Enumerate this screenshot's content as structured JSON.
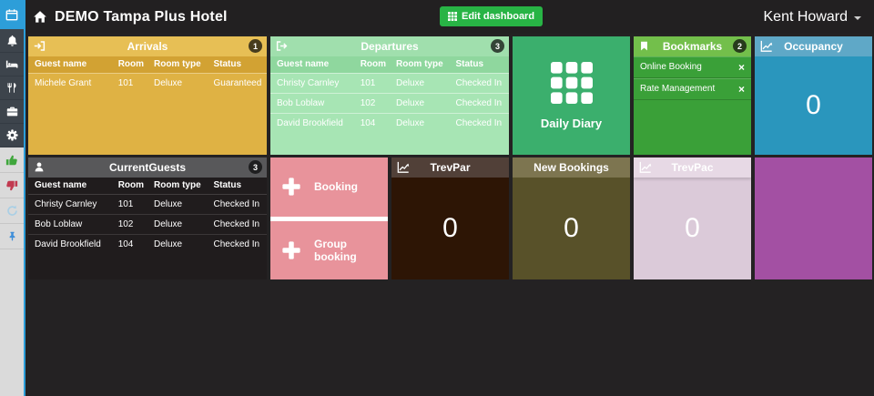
{
  "topbar": {
    "title": "DEMO Tampa Plus Hotel",
    "edit_button": "Edit dashboard",
    "user": "Kent Howard"
  },
  "sidebar": {
    "icons": [
      "calendar",
      "bell",
      "bed",
      "restaurant",
      "briefcase",
      "settings",
      "thumbs-up",
      "thumbs-down",
      "refresh",
      "pin"
    ]
  },
  "table_columns": [
    "Guest name",
    "Room",
    "Room type",
    "Status"
  ],
  "widgets": {
    "arrivals": {
      "title": "Arrivals",
      "badge": "1",
      "rows": [
        [
          "Michele Grant",
          "101",
          "Deluxe",
          "Guaranteed"
        ]
      ]
    },
    "departures": {
      "title": "Departures",
      "badge": "3",
      "rows": [
        [
          "Christy Carnley",
          "101",
          "Deluxe",
          "Checked In"
        ],
        [
          "Bob Loblaw",
          "102",
          "Deluxe",
          "Checked In"
        ],
        [
          "David Brookfield",
          "104",
          "Deluxe",
          "Checked In"
        ]
      ]
    },
    "daily_diary": {
      "label": "Daily Diary"
    },
    "bookmarks": {
      "title": "Bookmarks",
      "badge": "2",
      "items": [
        "Online Booking",
        "Rate Management"
      ],
      "close_glyph": "×"
    },
    "occupancy": {
      "title": "Occupancy",
      "value": "0"
    },
    "current_guests": {
      "title": "CurrentGuests",
      "badge": "3",
      "rows": [
        [
          "Christy Carnley",
          "101",
          "Deluxe",
          "Checked In"
        ],
        [
          "Bob Loblaw",
          "102",
          "Deluxe",
          "Checked In"
        ],
        [
          "David Brookfield",
          "104",
          "Deluxe",
          "Checked In"
        ]
      ]
    },
    "booking": {
      "label": "Booking"
    },
    "group_booking": {
      "label": "Group booking"
    },
    "trevpar": {
      "title": "TrevPar",
      "value": "0"
    },
    "new_bookings": {
      "title": "New Bookings",
      "value": "0"
    },
    "trevpac": {
      "title": "TrevPac",
      "value": "0"
    }
  },
  "colors": {
    "accent_blue": "#2d9ed9",
    "edit_green": "#28b445",
    "arrivals_gold": "#dfb244",
    "departures_green": "#a7e5b4",
    "diary_green": "#3baf6d",
    "bookmarks_green": "#3aa038",
    "occupancy_blue": "#2a96bd",
    "booking_pink": "#e8939b",
    "trevpar_brown": "#2d1505",
    "new_bookings_olive": "#585129",
    "trevpac_pink": "#dbcad9",
    "purple": "#a350a3"
  }
}
